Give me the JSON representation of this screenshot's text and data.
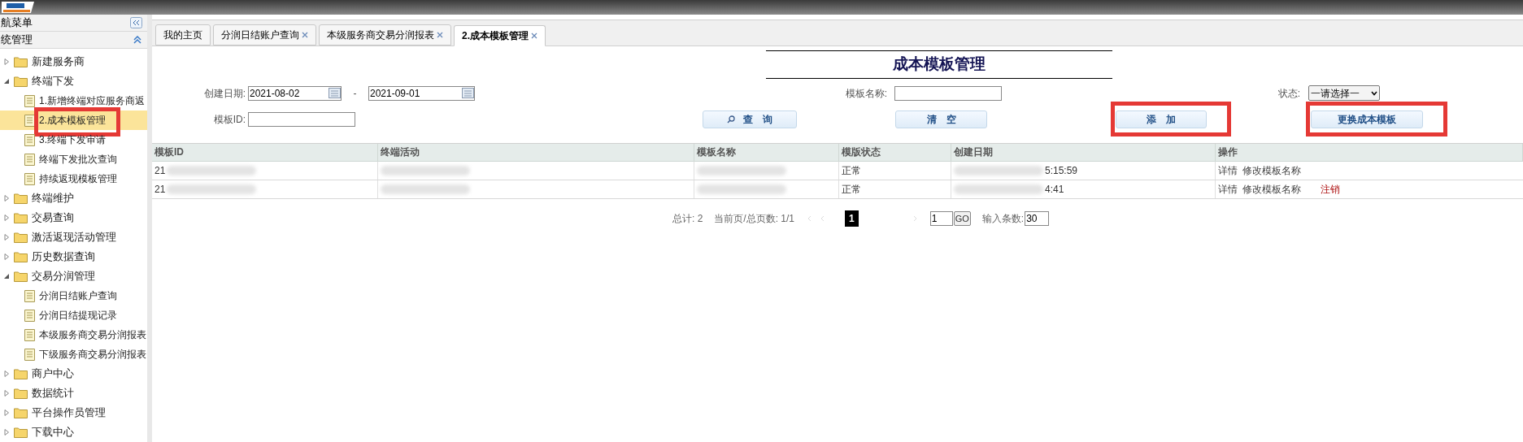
{
  "sidebar": {
    "header": "航菜单",
    "section": "统管理",
    "tree": [
      {
        "label": "新建服务商",
        "kind": "folder",
        "expanded": false
      },
      {
        "label": "终端下发",
        "kind": "folder",
        "expanded": true,
        "children": [
          {
            "label": "1.新增终端对应服务商返",
            "kind": "page",
            "selected": false,
            "annotated": false
          },
          {
            "label": "2.成本模板管理",
            "kind": "page",
            "selected": true,
            "annotated": true
          },
          {
            "label": "3.终端下发审请",
            "kind": "page",
            "selected": false,
            "annotated": false
          },
          {
            "label": "终端下发批次查询",
            "kind": "page",
            "selected": false,
            "annotated": false
          },
          {
            "label": "持续返现模板管理",
            "kind": "page",
            "selected": false,
            "annotated": false
          }
        ]
      },
      {
        "label": "终端维护",
        "kind": "folder",
        "expanded": false
      },
      {
        "label": "交易查询",
        "kind": "folder",
        "expanded": false
      },
      {
        "label": "激活返现活动管理",
        "kind": "folder",
        "expanded": false
      },
      {
        "label": "历史数据查询",
        "kind": "folder",
        "expanded": false
      },
      {
        "label": "交易分润管理",
        "kind": "folder",
        "expanded": true,
        "children": [
          {
            "label": "分润日结账户查询",
            "kind": "page",
            "selected": false,
            "annotated": false
          },
          {
            "label": "分润日结提现记录",
            "kind": "page",
            "selected": false,
            "annotated": false
          },
          {
            "label": "本级服务商交易分润报表",
            "kind": "page",
            "selected": false,
            "annotated": false
          },
          {
            "label": "下级服务商交易分润报表",
            "kind": "page",
            "selected": false,
            "annotated": false
          }
        ]
      },
      {
        "label": "商户中心",
        "kind": "folder",
        "expanded": false
      },
      {
        "label": "数据统计",
        "kind": "folder",
        "expanded": false
      },
      {
        "label": "平台操作员管理",
        "kind": "folder",
        "expanded": false
      },
      {
        "label": "下载中心",
        "kind": "folder",
        "expanded": false
      }
    ]
  },
  "tabs": [
    {
      "label": "我的主页",
      "closable": false,
      "selected": false
    },
    {
      "label": "分润日结账户查询",
      "closable": true,
      "selected": false
    },
    {
      "label": "本级服务商交易分润报表",
      "closable": true,
      "selected": false
    },
    {
      "label": "2.成本模板管理",
      "closable": true,
      "selected": true
    }
  ],
  "title": "成本模板管理",
  "form": {
    "date_label": "创建日期:",
    "date_from": "2021-08-02",
    "date_sep": "-",
    "date_to": "2021-09-01",
    "name_label": "模板名称:",
    "status_label": "状态:",
    "status_value": "一请选择一",
    "id_label": "模板ID:"
  },
  "buttons": [
    {
      "label": "查　询",
      "kind": "search",
      "annotated": false
    },
    {
      "label": "清　空",
      "kind": "plain",
      "annotated": false
    },
    {
      "label": "添　加",
      "kind": "plain",
      "annotated": true
    },
    {
      "label": "更换成本模板",
      "kind": "plain",
      "annotated": true
    }
  ],
  "table": {
    "columns": [
      "模板ID",
      "终端活动",
      "模板名称",
      "模版状态",
      "创建日期",
      "操作"
    ],
    "rows": [
      {
        "cells": [
          {
            "text": "21",
            "blurred": true
          },
          {
            "blurred": true
          },
          {
            "blurred": true
          },
          {
            "text": "正常",
            "blurred": false
          },
          {
            "text": "5:15:59",
            "blurred": true
          }
        ],
        "actions": [
          {
            "label": "详情",
            "kind": "link"
          },
          {
            "label": "修改模板名称",
            "kind": "link"
          }
        ]
      },
      {
        "cells": [
          {
            "text": "21",
            "blurred": true
          },
          {
            "blurred": true
          },
          {
            "blurred": true
          },
          {
            "text": "正常",
            "blurred": false
          },
          {
            "text": "4:41",
            "blurred": true
          }
        ],
        "actions": [
          {
            "label": "详情",
            "kind": "link"
          },
          {
            "label": "修改模板名称",
            "kind": "link"
          },
          {
            "label": "注销",
            "kind": "danger"
          }
        ]
      }
    ]
  },
  "pager": {
    "total": "总计: 2",
    "pages": "当前页/总页数: 1/1",
    "current": "1",
    "goto": "1",
    "go": "GO",
    "size_label": "输入条数:",
    "size": "30"
  }
}
